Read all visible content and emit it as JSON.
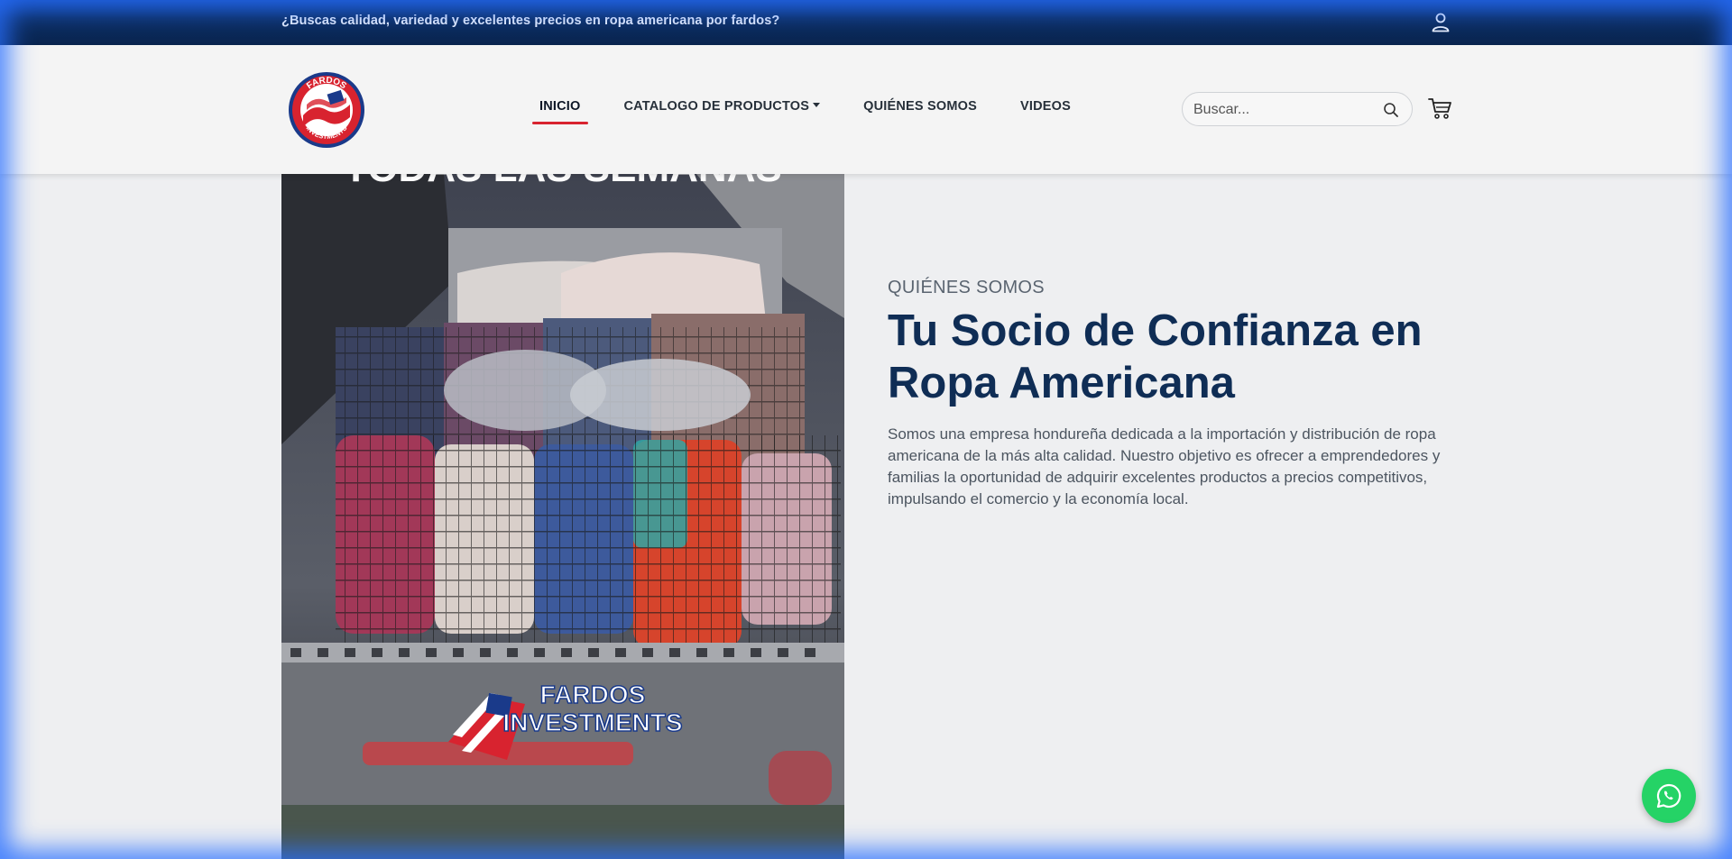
{
  "topbar": {
    "promo_text": "¿Buscas calidad, variedad y excelentes precios en ropa americana por fardos?",
    "user_icon": "user-icon"
  },
  "header": {
    "logo_top_text": "FARDOS",
    "logo_bottom_text": "INVESTMENTS",
    "nav": [
      {
        "label": "INICIO",
        "active": true
      },
      {
        "label": "CATALOGO DE PRODUCTOS",
        "dropdown": true
      },
      {
        "label": "QUIÉNES SOMOS"
      },
      {
        "label": "VIDEOS"
      }
    ],
    "search": {
      "placeholder": "Buscar...",
      "value": ""
    },
    "search_icon": "search-icon",
    "cart_icon": "cart-icon"
  },
  "hero": {
    "image_banner_top": "TODAS LAS SEMANAS",
    "image_logo_line1": "FARDOS",
    "image_logo_line2": "INVESTMENTS"
  },
  "about": {
    "kicker": "QUIÉNES SOMOS",
    "title": "Tu Socio de Confianza en Ropa Americana",
    "description": "Somos una empresa hondureña dedicada a la importación y distribución de ropa americana de la más alta calidad. Nuestro objetivo es ofrecer a emprendedores y familias la oportunidad de adquirir excelentes productos a precios competitivos, impulsando el comercio y la economía local."
  },
  "floating": {
    "whatsapp_icon": "whatsapp-icon"
  },
  "colors": {
    "topbar": "#0b2c5e",
    "accent_red": "#d8232f",
    "title_navy": "#0f2d55",
    "whatsapp_green": "#25d366"
  }
}
